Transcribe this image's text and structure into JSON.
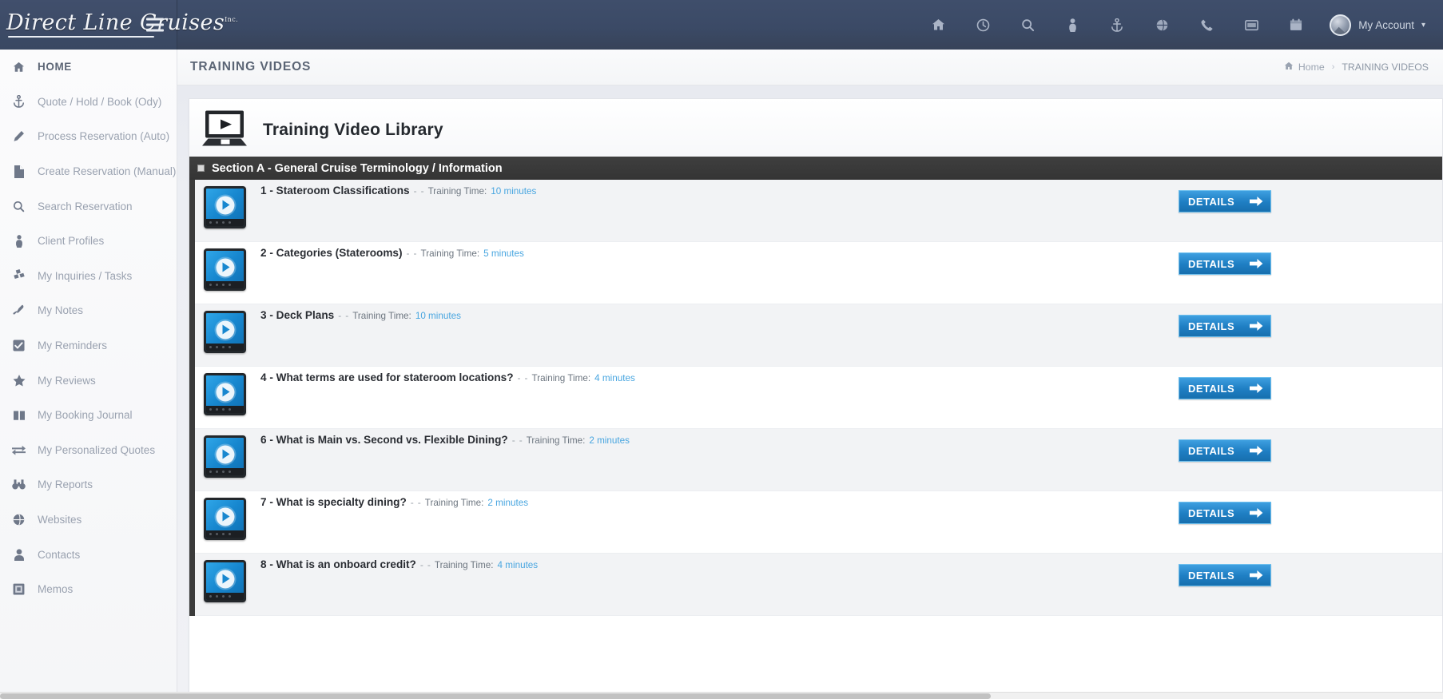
{
  "brand": {
    "logo_text": "Direct Line Cruises",
    "logo_tm": "Inc.",
    "hamburger_icon": "hamburger-menu-icon"
  },
  "topnav": {
    "icons": [
      {
        "name": "home-icon",
        "label": "Home"
      },
      {
        "name": "clock-icon",
        "label": "Recent"
      },
      {
        "name": "search-icon",
        "label": "Search"
      },
      {
        "name": "person-icon",
        "label": "Clients"
      },
      {
        "name": "anchor-icon",
        "label": "Cruises"
      },
      {
        "name": "globe-icon",
        "label": "Websites"
      },
      {
        "name": "phone-icon",
        "label": "Phone"
      },
      {
        "name": "envelope-icon",
        "label": "Messages"
      },
      {
        "name": "calendar-icon",
        "label": "Calendar"
      }
    ],
    "account_label": "My Account",
    "account_caret": "▾"
  },
  "sidebar": {
    "items": [
      {
        "label": "HOME",
        "icon": "home-icon",
        "active": true
      },
      {
        "label": "Quote / Hold / Book (Ody)",
        "icon": "anchor-icon",
        "active": false
      },
      {
        "label": "Process Reservation (Auto)",
        "icon": "pencil-icon",
        "active": false
      },
      {
        "label": "Create Reservation (Manual)",
        "icon": "document-icon",
        "active": false
      },
      {
        "label": "Search Reservation",
        "icon": "search-icon",
        "active": false
      },
      {
        "label": "Client Profiles",
        "icon": "person-icon",
        "active": false
      },
      {
        "label": "My Inquiries / Tasks",
        "icon": "tasks-icon",
        "active": false
      },
      {
        "label": "My Notes",
        "icon": "pen-icon",
        "active": false
      },
      {
        "label": "My Reminders",
        "icon": "checkbox-icon",
        "active": false
      },
      {
        "label": "My Reviews",
        "icon": "star-icon",
        "active": false
      },
      {
        "label": "My Booking Journal",
        "icon": "book-icon",
        "active": false
      },
      {
        "label": "My Personalized Quotes",
        "icon": "exchange-icon",
        "active": false
      },
      {
        "label": "My Reports",
        "icon": "binoculars-icon",
        "active": false
      },
      {
        "label": "Websites",
        "icon": "globe-icon",
        "active": false
      },
      {
        "label": "Contacts",
        "icon": "user-icon",
        "active": false
      },
      {
        "label": "Memos",
        "icon": "memo-icon",
        "active": false
      }
    ]
  },
  "page": {
    "title": "TRAINING VIDEOS",
    "breadcrumb": {
      "home_label": "Home",
      "separator": "›",
      "current": "TRAINING VIDEOS"
    }
  },
  "library": {
    "heading": "Training Video Library",
    "heading_icon": "laptop-play-icon",
    "section": {
      "bullet_icon": "square-bullet-icon",
      "title": "Section A - General Cruise Terminology / Information"
    },
    "training_time_label": "Training Time:",
    "dash": "-",
    "details_label": "DETAILS",
    "details_arrow_icon": "arrow-right-icon",
    "videos": [
      {
        "title": "1 - Stateroom Classifications",
        "time": "10 minutes"
      },
      {
        "title": "2 - Categories (Staterooms)",
        "time": "5 minutes"
      },
      {
        "title": "3 - Deck Plans",
        "time": "10 minutes"
      },
      {
        "title": "4 - What terms are used for stateroom locations?",
        "time": "4 minutes"
      },
      {
        "title": "6 - What is Main vs. Second vs. Flexible Dining?",
        "time": "2 minutes"
      },
      {
        "title": "7 - What is specialty dining?",
        "time": "2 minutes"
      },
      {
        "title": "8 - What is an onboard credit?",
        "time": "4 minutes"
      }
    ]
  },
  "colors": {
    "topbar": "#3b4a66",
    "section_bar": "#3a3a3a",
    "accent_blue": "#1f7fc4",
    "time_blue": "#49a6e0"
  }
}
